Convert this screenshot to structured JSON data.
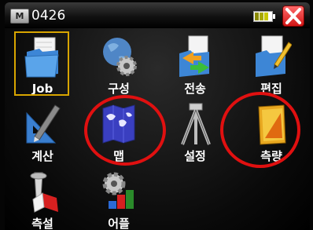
{
  "titlebar": {
    "badge": "M",
    "title": "0426"
  },
  "apps": [
    {
      "label": "Job"
    },
    {
      "label": "구성"
    },
    {
      "label": "전송"
    },
    {
      "label": "편집"
    },
    {
      "label": "계산"
    },
    {
      "label": "맵"
    },
    {
      "label": "설정"
    },
    {
      "label": "측량"
    },
    {
      "label": "측설"
    },
    {
      "label": "어플"
    }
  ],
  "icons": {
    "titlebar": [
      "m-logo-icon",
      "battery-icon",
      "close-icon"
    ],
    "apps": [
      "folder-icon",
      "globe-gear-icon",
      "transfer-icon",
      "edit-document-icon",
      "ruler-pencil-icon",
      "map-icon",
      "tripod-icon",
      "survey-book-icon",
      "stakeout-icon",
      "apps-gear-icon"
    ]
  },
  "colors": {
    "annotation": "#e01010",
    "selection": "#d8a500",
    "close": "#d21515"
  }
}
